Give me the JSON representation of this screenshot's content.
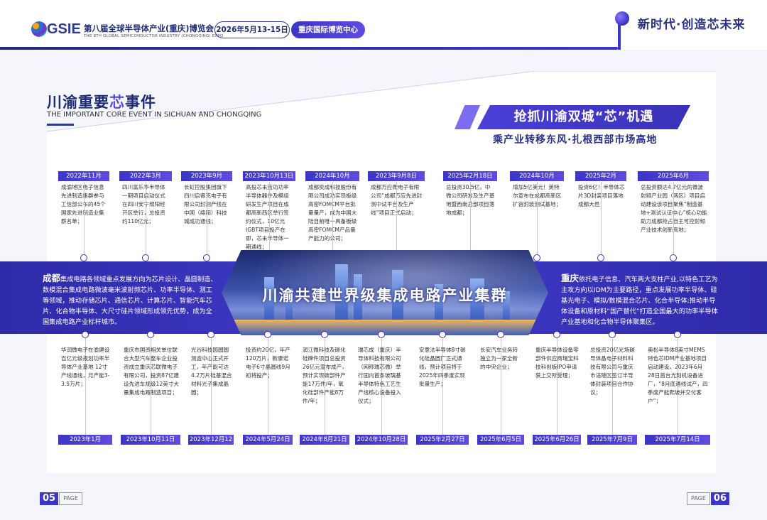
{
  "header": {
    "logo_text": "GSIE",
    "expo_title_cn": "第八届全球半导体产业(重庆)博览会",
    "expo_title_en": "THE 8TH GLOBAL SEMICONDUCTOR INDUSTRY (CHONGQING) EXPO",
    "date": "2026年5月13-15日",
    "venue": "重庆国际博览中心",
    "slogan": "新时代·创造芯未来",
    "accent_color": "#3b35c8"
  },
  "section": {
    "title_prefix": "川渝重要",
    "title_highlight": "芯",
    "title_suffix": "事件",
    "title_en": "THE IMPORTANT CORE EVENT IN SICHUAN AND CHONGQING",
    "banner": "抢抓川渝双城“芯”机遇",
    "subbanner": "乘产业转移东风·扎根西部市场高地"
  },
  "top_events": [
    {
      "date": "2022年11月",
      "text": "成渝地区电子信息先进制造集群参与工信部公布的45个国家先进制造业集群名单；"
    },
    {
      "date": "2022年3月",
      "text": "四川富乐华半导体一期项目启动仪式在四川安宁绵阳经开区举行，总投资约110亿元；"
    },
    {
      "date": "2023年9月",
      "text": "长虹控股集团旗下四川启睿克电子有限公司封测产线在中国（绵阳）科技城成功通线；"
    },
    {
      "date": "2023年10月13日",
      "text": "高投芯未蓝功功率半导体器件及模组研发生产项目在成都高新西区举行签约仪式，10亿元IGBT项目投产在即，芯未半导体一期通线；"
    },
    {
      "date": "2024年10月",
      "text": "成都奕成科技股份有限公司成功实现板级高密FOMCM平台批量量产，成为中国大陆目前唯一具备板级高密FOMCM产品量产能力的公司；"
    },
    {
      "date": "2023年9月8日",
      "text": "成都万应微电子有限公司“成都万应先进封测中试平台及生产线”项目正式启动；"
    },
    {
      "date": "2025年2月18日",
      "text": "总投资30.5亿，中微公司研发及生产基地暨西南总部项目落地成都；"
    },
    {
      "date": "2024年10月",
      "text": "增加5亿美元！英特尔宣布在成都高新区扩容封装测试基地；"
    },
    {
      "date": "2025年2月",
      "text": "投资6亿！半导体芯片3D封装项目落地成都大邑；"
    },
    {
      "date": "2025年6月",
      "text": "总投资额达4.7亿元的微波射频产业园（两区）项目启动建设该项目聚焦“制造基地+测试认证中心”核心功能助力成都抢占自主可控射频产业技术创新高地；"
    }
  ],
  "bottom_events": [
    {
      "date": "2023年1月",
      "text": "华润微电子在渝建设百亿元级规划功率半导体产业基地 12寸产线通线，月产能3-3.5万片；"
    },
    {
      "date": "2023年10月11日",
      "text": "重庆市国资相关单位联合大型汽车整车企业投资成立重庆芯联微电子有限公司，投资87亿建设先进车规级12英寸大量集成电路制造项目；"
    },
    {
      "date": "2023年12月12日",
      "text": "光谷科技园圆圆测造中心正式开工，年产能可达4.2万片硅基混合材料光子集成晶圆；"
    },
    {
      "date": "2024年5月24日",
      "text": "投资约20亿，年产120万片，新康诺电子6寸晶圆线9月初将投产；"
    },
    {
      "date": "2024年8月21日",
      "text": "润江微科技及碳化硅碲件项目总投资26亿元宣布成产，预计实现碳部件产能17万件/年，氧化硅部件产能8万件/年；"
    },
    {
      "date": "2024年10月28日",
      "text": "瑞芯成（重庆）半导体科技有限公司（网称瑞芯微）举行国内首条玻璃基半导体特色工艺生产线核心设备投入仪式；"
    },
    {
      "date": "2025年2月27日",
      "text": "安意法半导体8寸碳化硅晶圆厂正式通线，预计项目将于2025年四季度实现批量生产；"
    },
    {
      "date": "2025年6月5日",
      "text": "长安汽车业务转独立为一家全新的中央企业；"
    },
    {
      "date": "2025年6月26日",
      "text": "重庆半导体设备零部件供应商瑞宝科技科创板IPO申请获上交所受理；"
    },
    {
      "date": "2025年7月9日",
      "text": "总投资20亿光场碳导体晶电子材料科技有限公司与重庆市涪陵区签订半导体封装项目合作协议；"
    },
    {
      "date": "2025年7月14日",
      "text": "奥松半导体8英寸MEMS特色芯IDM产业基地项目启动建设，2023年6月28日首台光刻机设备进厂，“8月底通线试产，四季度产能爬坡并交付客户”；"
    }
  ],
  "chengdu": {
    "name": "成都",
    "text": "集成电路各领域重点发展方向为芯片设计、晶圆制造、数模混合集成电路微波毫米波射频芯片、功率半导体、测工等领域，推动存储芯片、通信芯片、计算芯片、智能汽车芯片、化合物半导体、大尺寸硅片领域形成领先优势，成为全国集成电路产业标杆城市。"
  },
  "chongqing": {
    "name": "重庆",
    "text": "依托电子信息、汽车两大支柱产业,以特色工艺为主攻方向以IDM为主要路径，重点发展功率半导体、硅基光电子、模拟/数模混合芯片、化合半导体;推动半导体设备和原材料“国产替代”打造全国最大的功率半导体产业基地和化合物半导体聚集区。"
  },
  "hero_title": "川渝共建世界级集成电路产业集群",
  "footer": {
    "left_page": "05",
    "right_page": "06",
    "page_word": "PAGE"
  }
}
